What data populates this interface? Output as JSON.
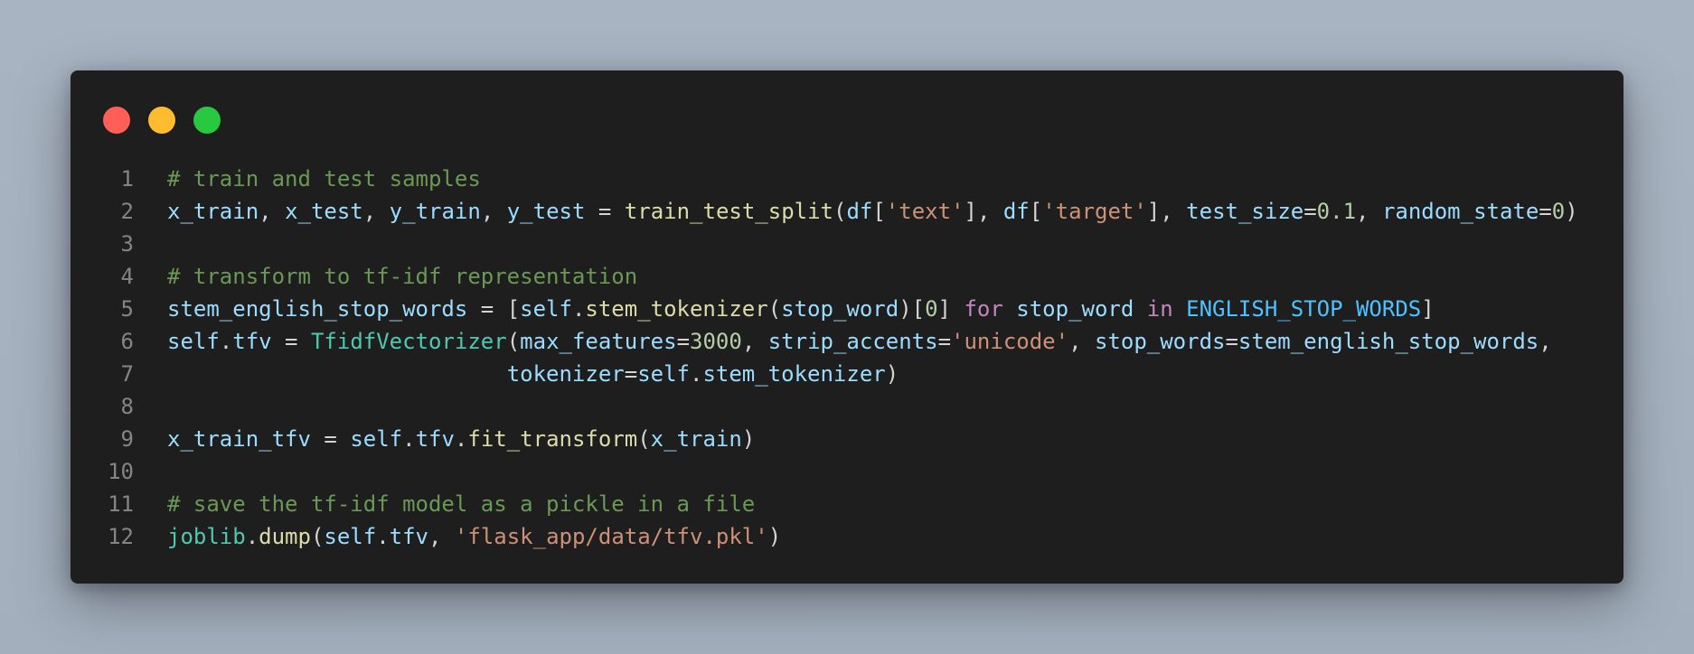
{
  "window": {
    "controls": {
      "close_color": "#ff5f57",
      "minimize_color": "#febc2e",
      "maximize_color": "#28c840"
    }
  },
  "code": {
    "lines": [
      {
        "number": "1",
        "tokens": [
          {
            "text": "# train and test samples",
            "type": "comment"
          }
        ]
      },
      {
        "number": "2",
        "tokens": [
          {
            "text": "x_train",
            "type": "var"
          },
          {
            "text": ", ",
            "type": "op"
          },
          {
            "text": "x_test",
            "type": "var"
          },
          {
            "text": ", ",
            "type": "op"
          },
          {
            "text": "y_train",
            "type": "var"
          },
          {
            "text": ", ",
            "type": "op"
          },
          {
            "text": "y_test",
            "type": "var"
          },
          {
            "text": " = ",
            "type": "op"
          },
          {
            "text": "train_test_split",
            "type": "func"
          },
          {
            "text": "(",
            "type": "op"
          },
          {
            "text": "df",
            "type": "var"
          },
          {
            "text": "[",
            "type": "op"
          },
          {
            "text": "'text'",
            "type": "str"
          },
          {
            "text": "], ",
            "type": "op"
          },
          {
            "text": "df",
            "type": "var"
          },
          {
            "text": "[",
            "type": "op"
          },
          {
            "text": "'target'",
            "type": "str"
          },
          {
            "text": "], ",
            "type": "op"
          },
          {
            "text": "test_size",
            "type": "var"
          },
          {
            "text": "=",
            "type": "op"
          },
          {
            "text": "0.1",
            "type": "num"
          },
          {
            "text": ", ",
            "type": "op"
          },
          {
            "text": "random_state",
            "type": "var"
          },
          {
            "text": "=",
            "type": "op"
          },
          {
            "text": "0",
            "type": "num"
          },
          {
            "text": ")",
            "type": "op"
          }
        ]
      },
      {
        "number": "3",
        "tokens": []
      },
      {
        "number": "4",
        "tokens": [
          {
            "text": "# transform to tf-idf representation",
            "type": "comment"
          }
        ]
      },
      {
        "number": "5",
        "tokens": [
          {
            "text": "stem_english_stop_words",
            "type": "var"
          },
          {
            "text": " = [",
            "type": "op"
          },
          {
            "text": "self",
            "type": "var"
          },
          {
            "text": ".",
            "type": "op"
          },
          {
            "text": "stem_tokenizer",
            "type": "func"
          },
          {
            "text": "(",
            "type": "op"
          },
          {
            "text": "stop_word",
            "type": "var"
          },
          {
            "text": ")[",
            "type": "op"
          },
          {
            "text": "0",
            "type": "num"
          },
          {
            "text": "] ",
            "type": "op"
          },
          {
            "text": "for",
            "type": "kw"
          },
          {
            "text": " ",
            "type": "op"
          },
          {
            "text": "stop_word",
            "type": "var"
          },
          {
            "text": " ",
            "type": "op"
          },
          {
            "text": "in",
            "type": "kw"
          },
          {
            "text": " ",
            "type": "op"
          },
          {
            "text": "ENGLISH_STOP_WORDS",
            "type": "const"
          },
          {
            "text": "]",
            "type": "op"
          }
        ]
      },
      {
        "number": "6",
        "tokens": [
          {
            "text": "self",
            "type": "var"
          },
          {
            "text": ".",
            "type": "op"
          },
          {
            "text": "tfv",
            "type": "var"
          },
          {
            "text": " = ",
            "type": "op"
          },
          {
            "text": "TfidfVectorizer",
            "type": "class"
          },
          {
            "text": "(",
            "type": "op"
          },
          {
            "text": "max_features",
            "type": "var"
          },
          {
            "text": "=",
            "type": "op"
          },
          {
            "text": "3000",
            "type": "num"
          },
          {
            "text": ", ",
            "type": "op"
          },
          {
            "text": "strip_accents",
            "type": "var"
          },
          {
            "text": "=",
            "type": "op"
          },
          {
            "text": "'unicode'",
            "type": "str"
          },
          {
            "text": ", ",
            "type": "op"
          },
          {
            "text": "stop_words",
            "type": "var"
          },
          {
            "text": "=",
            "type": "op"
          },
          {
            "text": "stem_english_stop_words",
            "type": "var"
          },
          {
            "text": ",",
            "type": "op"
          }
        ]
      },
      {
        "number": "7",
        "tokens": [
          {
            "text": "                          ",
            "type": "op"
          },
          {
            "text": "tokenizer",
            "type": "var"
          },
          {
            "text": "=",
            "type": "op"
          },
          {
            "text": "self",
            "type": "var"
          },
          {
            "text": ".",
            "type": "op"
          },
          {
            "text": "stem_tokenizer",
            "type": "var"
          },
          {
            "text": ")",
            "type": "op"
          }
        ]
      },
      {
        "number": "8",
        "tokens": []
      },
      {
        "number": "9",
        "tokens": [
          {
            "text": "x_train_tfv",
            "type": "var"
          },
          {
            "text": " = ",
            "type": "op"
          },
          {
            "text": "self",
            "type": "var"
          },
          {
            "text": ".",
            "type": "op"
          },
          {
            "text": "tfv",
            "type": "var"
          },
          {
            "text": ".",
            "type": "op"
          },
          {
            "text": "fit_transform",
            "type": "func"
          },
          {
            "text": "(",
            "type": "op"
          },
          {
            "text": "x_train",
            "type": "var"
          },
          {
            "text": ")",
            "type": "op"
          }
        ]
      },
      {
        "number": "10",
        "tokens": []
      },
      {
        "number": "11",
        "tokens": [
          {
            "text": "# save the tf-idf model as a pickle in a file",
            "type": "comment"
          }
        ]
      },
      {
        "number": "12",
        "tokens": [
          {
            "text": "joblib",
            "type": "class"
          },
          {
            "text": ".",
            "type": "op"
          },
          {
            "text": "dump",
            "type": "func"
          },
          {
            "text": "(",
            "type": "op"
          },
          {
            "text": "self",
            "type": "var"
          },
          {
            "text": ".",
            "type": "op"
          },
          {
            "text": "tfv",
            "type": "var"
          },
          {
            "text": ", ",
            "type": "op"
          },
          {
            "text": "'flask_app/data/tfv.pkl'",
            "type": "str"
          },
          {
            "text": ")",
            "type": "op"
          }
        ]
      }
    ]
  }
}
